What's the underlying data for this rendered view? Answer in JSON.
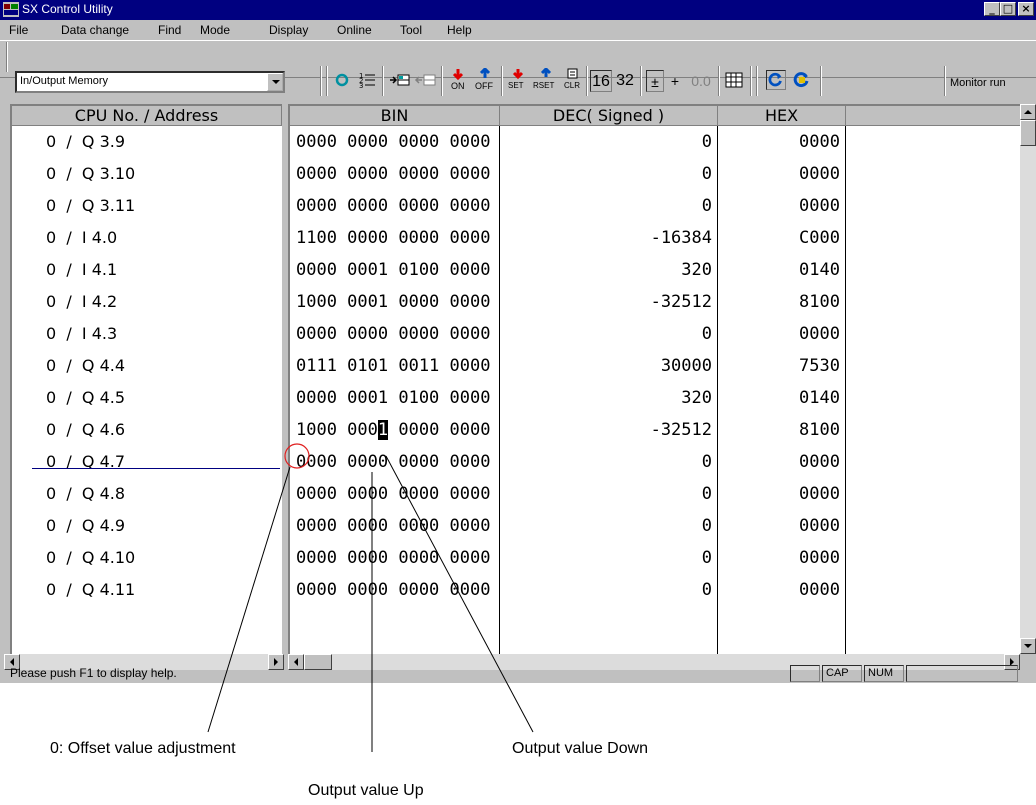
{
  "window": {
    "title": "SX Control Utility"
  },
  "menu": [
    {
      "label": "File"
    },
    {
      "label": "Data change"
    },
    {
      "label": "Find"
    },
    {
      "label": "Mode"
    },
    {
      "label": "Display"
    },
    {
      "label": "Online"
    },
    {
      "label": "Tool"
    },
    {
      "label": "Help"
    }
  ],
  "toolbar": {
    "memory_select": "In/Output Memory",
    "on_label": "ON",
    "off_label": "OFF",
    "set_label": "SET",
    "rset_label": "RSET",
    "clr_label": "CLR",
    "bits16": "16",
    "bits32": "32",
    "plusminus": "±",
    "plus": "+",
    "float_label": "0.0",
    "monitor_button": "Monitor run"
  },
  "columns": {
    "address": "CPU No. / Address",
    "bin": "BIN",
    "dec": "DEC( Signed )",
    "hex": "HEX"
  },
  "rows": [
    {
      "address": "0  /  Q 3.9",
      "bin": "0000 0000 0000 0000",
      "dec": "0",
      "hex": "0000"
    },
    {
      "address": "0  /  Q 3.10",
      "bin": "0000 0000 0000 0000",
      "dec": "0",
      "hex": "0000"
    },
    {
      "address": "0  /  Q 3.11",
      "bin": "0000 0000 0000 0000",
      "dec": "0",
      "hex": "0000"
    },
    {
      "address": "0  /  I 4.0",
      "bin": "1100 0000 0000 0000",
      "dec": "-16384",
      "hex": "C000"
    },
    {
      "address": "0  /  I 4.1",
      "bin": "0000 0001 0100 0000",
      "dec": "320",
      "hex": "0140"
    },
    {
      "address": "0  /  I 4.2",
      "bin": "1000 0001 0000 0000",
      "dec": "-32512",
      "hex": "8100"
    },
    {
      "address": "0  /  I 4.3",
      "bin": "0000 0000 0000 0000",
      "dec": "0",
      "hex": "0000"
    },
    {
      "address": "0  /  Q 4.4",
      "bin": "0111 0101 0011 0000",
      "dec": "30000",
      "hex": "7530"
    },
    {
      "address": "0  /  Q 4.5",
      "bin": "0000 0001 0100 0000",
      "dec": "320",
      "hex": "0140"
    },
    {
      "address": "0  /  Q 4.6",
      "bin": "1000 0001 0000 0000",
      "dec": "-32512",
      "hex": "8100",
      "selected": true
    },
    {
      "address": "0  /  Q 4.7",
      "bin": "0000 0000 0000 0000",
      "dec": "0",
      "hex": "0000"
    },
    {
      "address": "0  /  Q 4.8",
      "bin": "0000 0000 0000 0000",
      "dec": "0",
      "hex": "0000"
    },
    {
      "address": "0  /  Q 4.9",
      "bin": "0000 0000 0000 0000",
      "dec": "0",
      "hex": "0000"
    },
    {
      "address": "0  /  Q 4.10",
      "bin": "0000 0000 0000 0000",
      "dec": "0",
      "hex": "0000"
    },
    {
      "address": "0  /  Q 4.11",
      "bin": "0000 0000 0000 0000",
      "dec": "0",
      "hex": "0000"
    }
  ],
  "status": {
    "text": "Please push F1 to display help.",
    "cap": "CAP",
    "num": "NUM"
  },
  "annotations": {
    "offset": "0: Offset value adjustment",
    "down": "Output value Down",
    "up": "Output value Up"
  },
  "colors": {
    "titlebar": "#000080",
    "face": "#c0c0c0",
    "selection_line": "#000080",
    "callout_circle": "#e02020"
  }
}
